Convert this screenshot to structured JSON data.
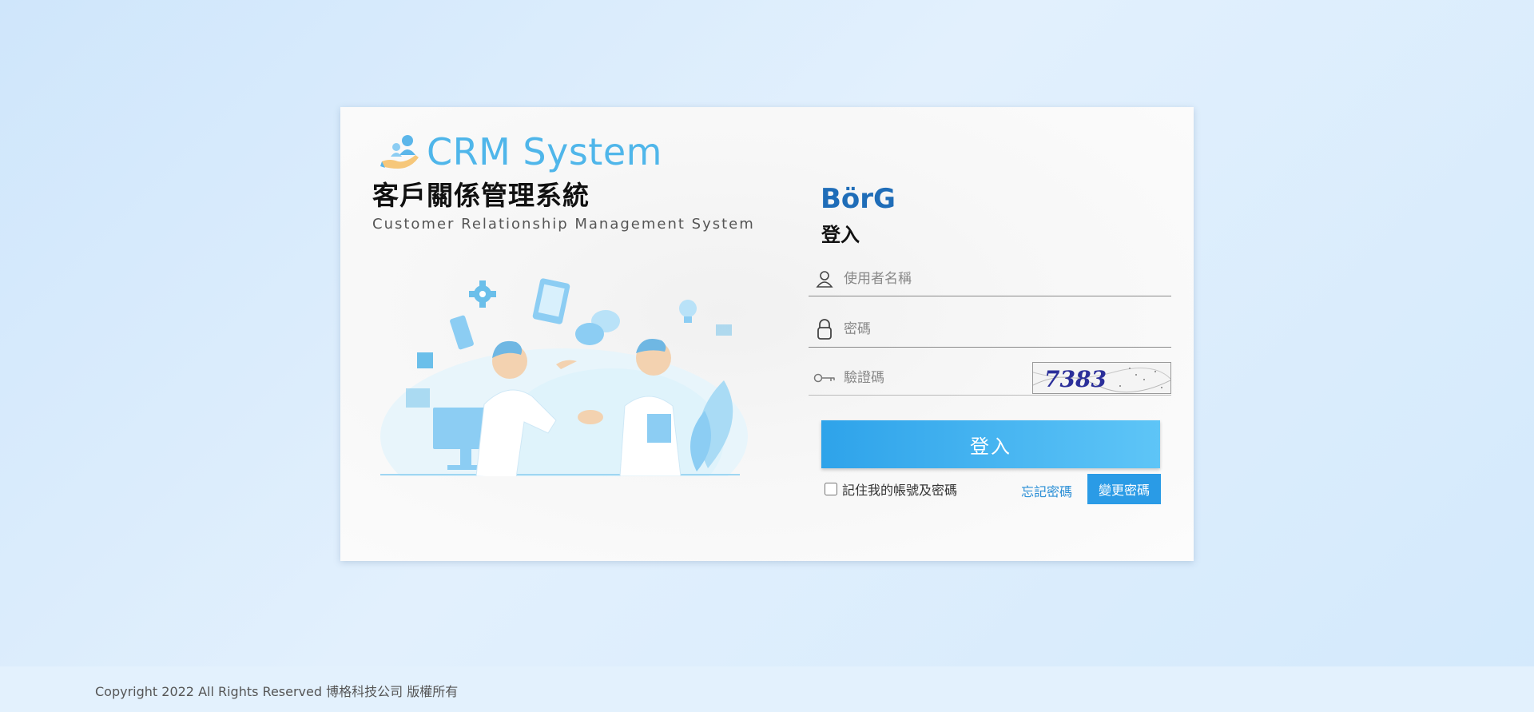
{
  "brand": {
    "title": "CRM System",
    "zh_title": "客戶關係管理系統",
    "en_subtitle": "Customer Relationship Management System"
  },
  "login": {
    "logo_text": "BörG",
    "heading": "登入",
    "username_placeholder": "使用者名稱",
    "password_placeholder": "密碼",
    "captcha_placeholder": "驗證碼",
    "captcha_code": "7383",
    "submit_label": "登入",
    "remember_label": "記住我的帳號及密碼",
    "forgot_label": "忘記密碼",
    "change_password_label": "變更密碼"
  },
  "footer": {
    "copyright": "Copyright 2022 All Rights Reserved 博格科技公司 版權所有"
  },
  "colors": {
    "accent": "#2ea3ea",
    "brand_title": "#4fb6ea",
    "logo_blue": "#1f6db8",
    "logo_orange": "#f5a623"
  }
}
